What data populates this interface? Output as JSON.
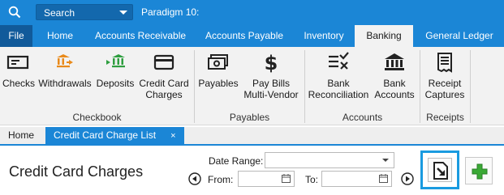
{
  "titlebar": {
    "search_placeholder": "Search",
    "app_title": "Paradigm 10:"
  },
  "tabs": [
    {
      "label": "File"
    },
    {
      "label": "Home"
    },
    {
      "label": "Accounts Receivable"
    },
    {
      "label": "Accounts Payable"
    },
    {
      "label": "Inventory"
    },
    {
      "label": "Banking",
      "active": true
    },
    {
      "label": "General Ledger"
    }
  ],
  "ribbon": {
    "checks": "Checks",
    "withdrawals": "Withdrawals",
    "deposits": "Deposits",
    "credit_card_charges_l1": "Credit Card",
    "credit_card_charges_l2": "Charges",
    "payables": "Payables",
    "pay_bills_l1": "Pay Bills",
    "pay_bills_l2": "Multi-Vendor",
    "bank_reconciliation_l1": "Bank",
    "bank_reconciliation_l2": "Reconciliation",
    "bank_accounts_l1": "Bank",
    "bank_accounts_l2": "Accounts",
    "receipt_captures_l1": "Receipt",
    "receipt_captures_l2": "Captures",
    "groups": {
      "checkbook": "Checkbook",
      "payables": "Payables",
      "accounts": "Accounts",
      "receipts": "Receipts"
    }
  },
  "doctabs": {
    "home": "Home",
    "active": "Credit Card Charge List",
    "close": "×"
  },
  "content": {
    "page_title": "Credit Card Charges",
    "date_range_label": "Date Range:",
    "from_label": "From:",
    "to_label": "To:",
    "date_range_value": "",
    "from_value": "",
    "to_value": ""
  },
  "colors": {
    "brand_blue": "#1b86d6",
    "file_tab": "#115a9a",
    "add_green": "#3aa935",
    "highlight": "#1a9be0"
  }
}
